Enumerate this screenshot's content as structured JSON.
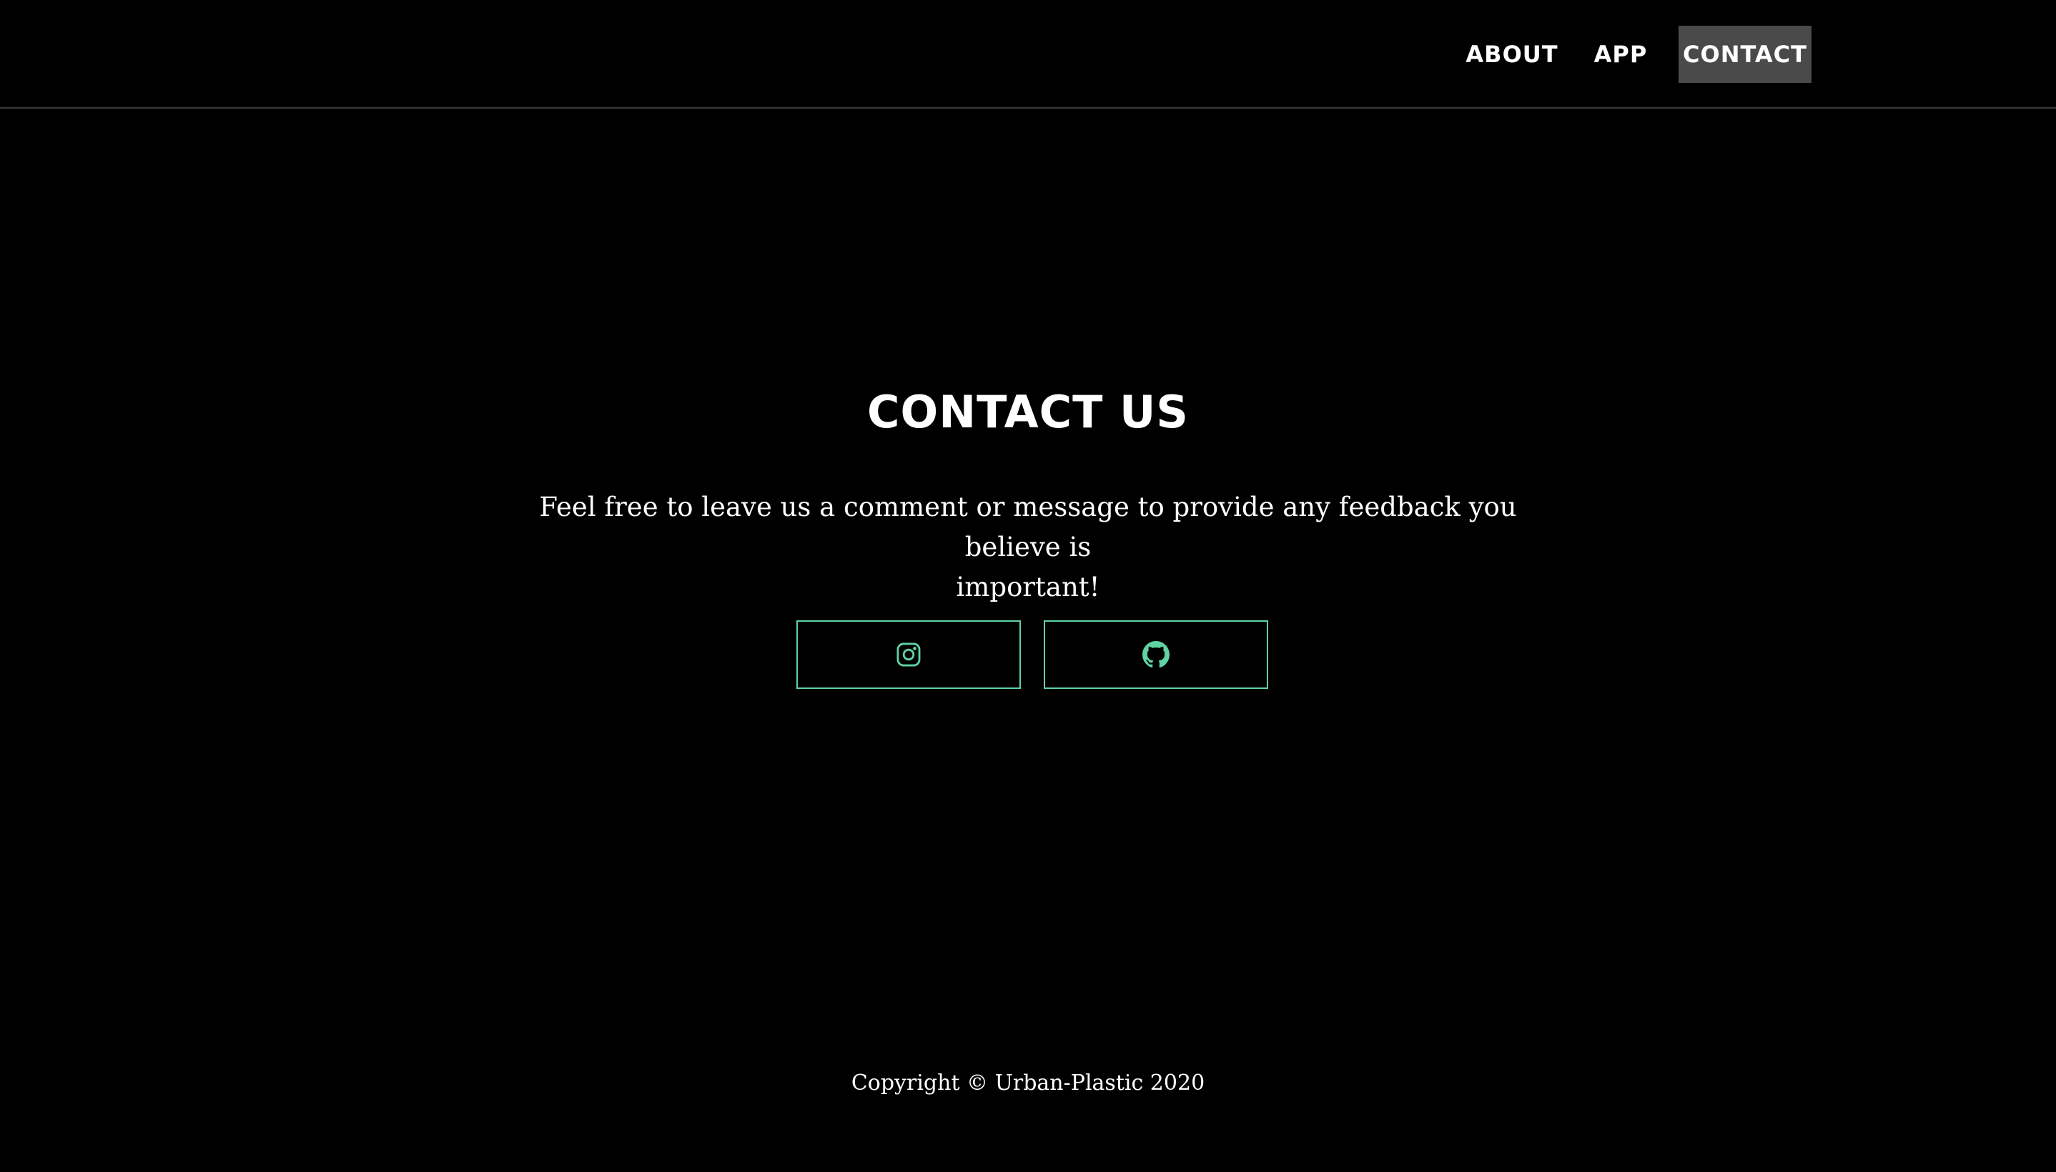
{
  "nav": {
    "items": [
      {
        "label": "ABOUT"
      },
      {
        "label": "APP"
      },
      {
        "label": "CONTACT",
        "active": true
      }
    ]
  },
  "main": {
    "heading": "CONTACT US",
    "intro_line1": "Feel free to leave us a comment or message to provide any feedback you believe is",
    "intro_line2": "important!",
    "social_buttons": [
      {
        "icon": "instagram-icon"
      },
      {
        "icon": "github-icon"
      }
    ]
  },
  "footer": {
    "copyright": "Copyright © Urban-Plastic 2020"
  },
  "colors": {
    "background": "#000000",
    "text": "#ffffff",
    "accent": "#5fd3a3",
    "nav_active_bg": "#4a4a4a",
    "divider": "#3a3a3a"
  }
}
